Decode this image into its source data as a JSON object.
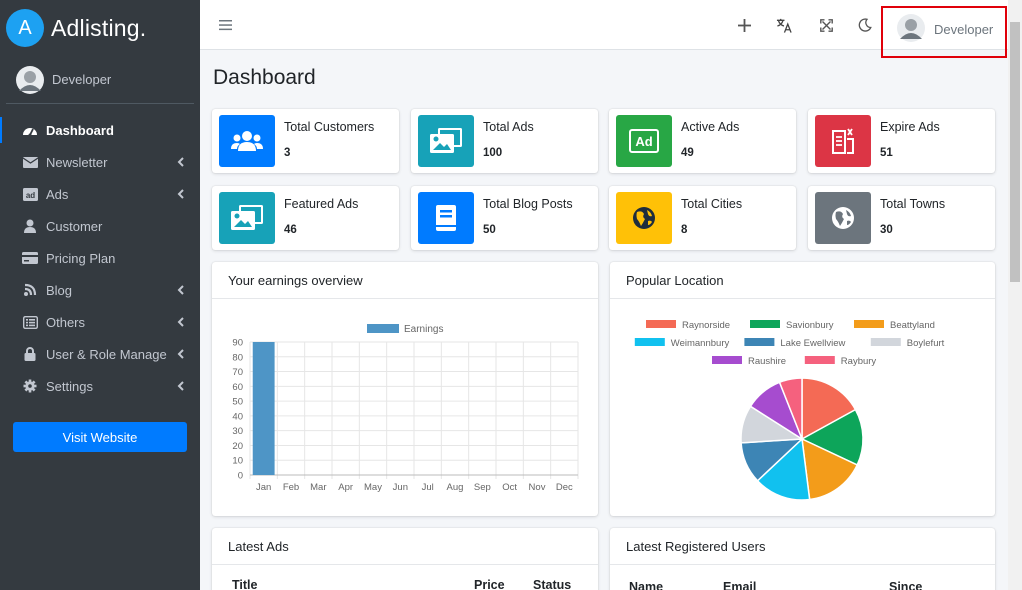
{
  "brand": {
    "logo_letter": "A",
    "name": "Adlisting."
  },
  "user": {
    "name": "Developer"
  },
  "sidebar": {
    "items": [
      {
        "label": "Dashboard",
        "icon": "dashboard-gauge-icon",
        "active": true,
        "has_children": false
      },
      {
        "label": "Newsletter",
        "icon": "envelope-icon",
        "active": false,
        "has_children": true
      },
      {
        "label": "Ads",
        "icon": "ad-icon",
        "active": false,
        "has_children": true
      },
      {
        "label": "Customer",
        "icon": "user-icon",
        "active": false,
        "has_children": false
      },
      {
        "label": "Pricing Plan",
        "icon": "credit-card-icon",
        "active": false,
        "has_children": false
      },
      {
        "label": "Blog",
        "icon": "blog-icon",
        "active": false,
        "has_children": true
      },
      {
        "label": "Others",
        "icon": "list-icon",
        "active": false,
        "has_children": true
      },
      {
        "label": "User & Role Manage",
        "icon": "lock-icon",
        "active": false,
        "has_children": true
      },
      {
        "label": "Settings",
        "icon": "gear-icon",
        "active": false,
        "has_children": true
      }
    ],
    "visit_button": "Visit Website"
  },
  "header": {
    "icons": [
      "menu-icon",
      "plus-icon",
      "translate-icon",
      "fullscreen-icon",
      "moon-icon"
    ],
    "user_name": "Developer"
  },
  "page_title": "Dashboard",
  "stats": [
    {
      "label": "Total Customers",
      "value": "3",
      "color": "#007bff",
      "icon": "users-icon"
    },
    {
      "label": "Total Ads",
      "value": "100",
      "color": "#17a2b8",
      "icon": "images-icon"
    },
    {
      "label": "Active Ads",
      "value": "49",
      "color": "#28a745",
      "icon": "ad-icon"
    },
    {
      "label": "Expire Ads",
      "value": "51",
      "color": "#dc3545",
      "icon": "expired-ad-icon"
    },
    {
      "label": "Featured Ads",
      "value": "46",
      "color": "#17a2b8",
      "icon": "images-icon"
    },
    {
      "label": "Total Blog Posts",
      "value": "50",
      "color": "#007bff",
      "icon": "book-icon"
    },
    {
      "label": "Total Cities",
      "value": "8",
      "color": "#ffc107",
      "icon": "globe-icon"
    },
    {
      "label": "Total Towns",
      "value": "30",
      "color": "#6c757d",
      "icon": "globe-icon"
    }
  ],
  "earnings_card": {
    "title": "Your earnings overview"
  },
  "location_card": {
    "title": "Popular Location"
  },
  "latest_ads": {
    "title": "Latest Ads",
    "columns": [
      "Title",
      "Price",
      "Status"
    ]
  },
  "latest_users": {
    "title": "Latest Registered Users",
    "columns": [
      "Name",
      "Email",
      "Since"
    ]
  },
  "chart_data": [
    {
      "type": "bar",
      "categories": [
        "Jan",
        "Feb",
        "Mar",
        "Apr",
        "May",
        "Jun",
        "Jul",
        "Aug",
        "Sep",
        "Oct",
        "Nov",
        "Dec"
      ],
      "series": [
        {
          "name": "Earnings",
          "values": [
            90,
            0,
            0,
            0,
            0,
            0,
            0,
            0,
            0,
            0,
            0,
            0
          ],
          "color": "#4e95c6"
        }
      ],
      "ylim": [
        0,
        90
      ],
      "yticks": [
        0,
        10,
        20,
        30,
        40,
        50,
        60,
        70,
        80,
        90
      ],
      "grid": true,
      "legend": "top"
    },
    {
      "type": "pie",
      "labels": [
        "Raynorside",
        "Savionbury",
        "Beattyland",
        "Weimannbury",
        "Lake Ewellview",
        "Boylefurt",
        "Raushire",
        "Raybury"
      ],
      "values": [
        17,
        15,
        16,
        15,
        11,
        10,
        10,
        6
      ],
      "colors": [
        "#f46a55",
        "#0da55a",
        "#f39c1a",
        "#11c1ef",
        "#3d85b5",
        "#d2d6dc",
        "#a64ccf",
        "#f5617e"
      ],
      "legend": "top"
    }
  ]
}
